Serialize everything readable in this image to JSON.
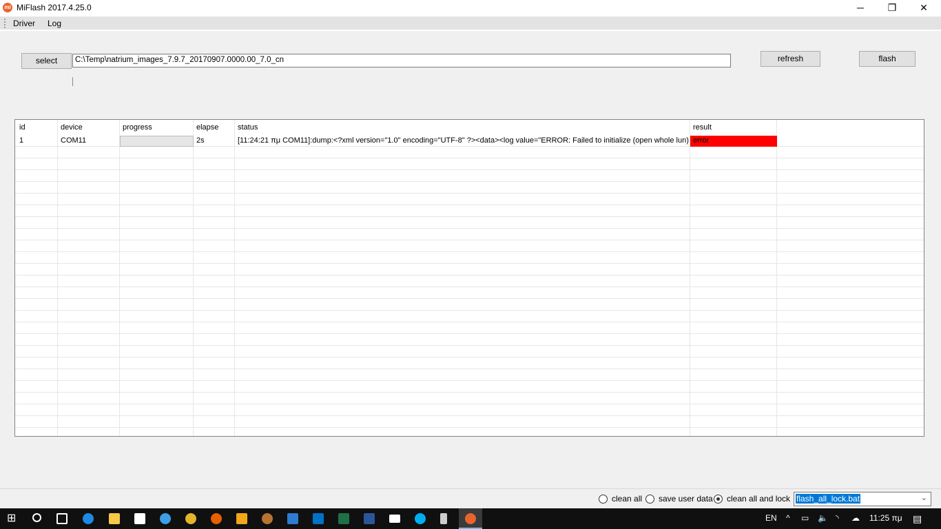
{
  "window": {
    "title": "MiFlash 2017.4.25.0",
    "logo": "mi",
    "minimize": "─",
    "restore": "❐",
    "close": "✕"
  },
  "menu": [
    "Driver",
    "Log"
  ],
  "toolbar": {
    "select": "select",
    "path": "C:\\Temp\\natrium_images_7.9.7_20170907.0000.00_7.0_cn",
    "refresh": "refresh",
    "flash": "flash"
  },
  "table": {
    "headers": [
      "id",
      "device",
      "progress",
      "elapse",
      "status",
      "result"
    ],
    "rows": [
      {
        "id": "1",
        "device": "COM11",
        "progress": 0,
        "elapse": "2s",
        "status": "[11:24:21 πμ  COM11]:dump:<?xml version=\"1.0\" encoding=\"UTF-8\" ?><data><log value=\"ERROR: Failed to initialize (open whole lun)...",
        "result": "error"
      }
    ]
  },
  "options": {
    "clean_all": "clean all",
    "save_user_data": "save user data",
    "clean_all_lock": "clean all and lock",
    "selected": "clean_all_lock",
    "script": "flash_all_lock.bat"
  },
  "colors": {
    "error": "#ff0000",
    "selection": "#0078d7"
  },
  "taskbar": {
    "lang": "EN",
    "time": "11:25 πμ"
  }
}
